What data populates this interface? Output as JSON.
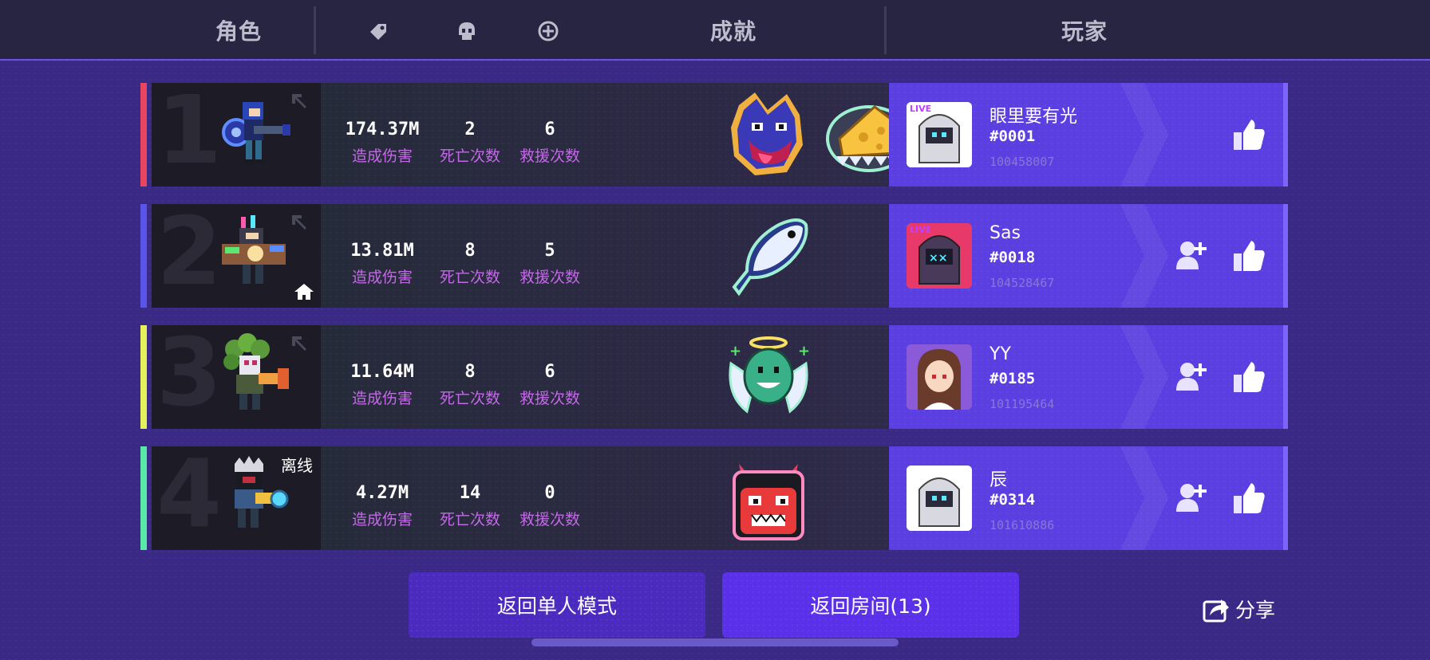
{
  "header": {
    "role_label": "角色",
    "achievement_label": "成就",
    "player_label": "玩家",
    "icons": [
      "tag-icon",
      "skull-icon",
      "revive-plus-icon"
    ]
  },
  "rows": [
    {
      "rank": "1",
      "accent_color": "#e8455f",
      "damage": "174.37M",
      "damage_label": "造成伤害",
      "deaths": "2",
      "deaths_label": "死亡次数",
      "rescues": "6",
      "rescues_label": "救援次数",
      "badges": [
        "wolf-badge-icon",
        "cheese-badge-icon"
      ],
      "player": {
        "name": "眼里要有光",
        "tag": "#0001",
        "id": "100458007"
      },
      "is_host": false,
      "offline": ""
    },
    {
      "rank": "2",
      "accent_color": "#5a55e8",
      "damage": "13.81M",
      "damage_label": "造成伤害",
      "deaths": "8",
      "deaths_label": "死亡次数",
      "rescues": "5",
      "rescues_label": "救援次数",
      "badges": [
        "fish-badge-icon"
      ],
      "player": {
        "name": "Sas",
        "tag": "#0018",
        "id": "104528467"
      },
      "is_host": true,
      "offline": ""
    },
    {
      "rank": "3",
      "accent_color": "#e6f05a",
      "damage": "11.64M",
      "damage_label": "造成伤害",
      "deaths": "8",
      "deaths_label": "死亡次数",
      "rescues": "6",
      "rescues_label": "救援次数",
      "badges": [
        "angel-badge-icon"
      ],
      "player": {
        "name": "YY",
        "tag": "#0185",
        "id": "101195464"
      },
      "is_host": false,
      "offline": ""
    },
    {
      "rank": "4",
      "accent_color": "#5ae8a8",
      "damage": "4.27M",
      "damage_label": "造成伤害",
      "deaths": "14",
      "deaths_label": "死亡次数",
      "rescues": "0",
      "rescues_label": "救援次数",
      "badges": [
        "demon-badge-icon"
      ],
      "player": {
        "name": "辰",
        "tag": "#0314",
        "id": "101610886"
      },
      "is_host": false,
      "offline": "离线"
    }
  ],
  "buttons": {
    "back_single": "返回单人模式",
    "back_room": "返回房间(13)",
    "share": "分享"
  }
}
